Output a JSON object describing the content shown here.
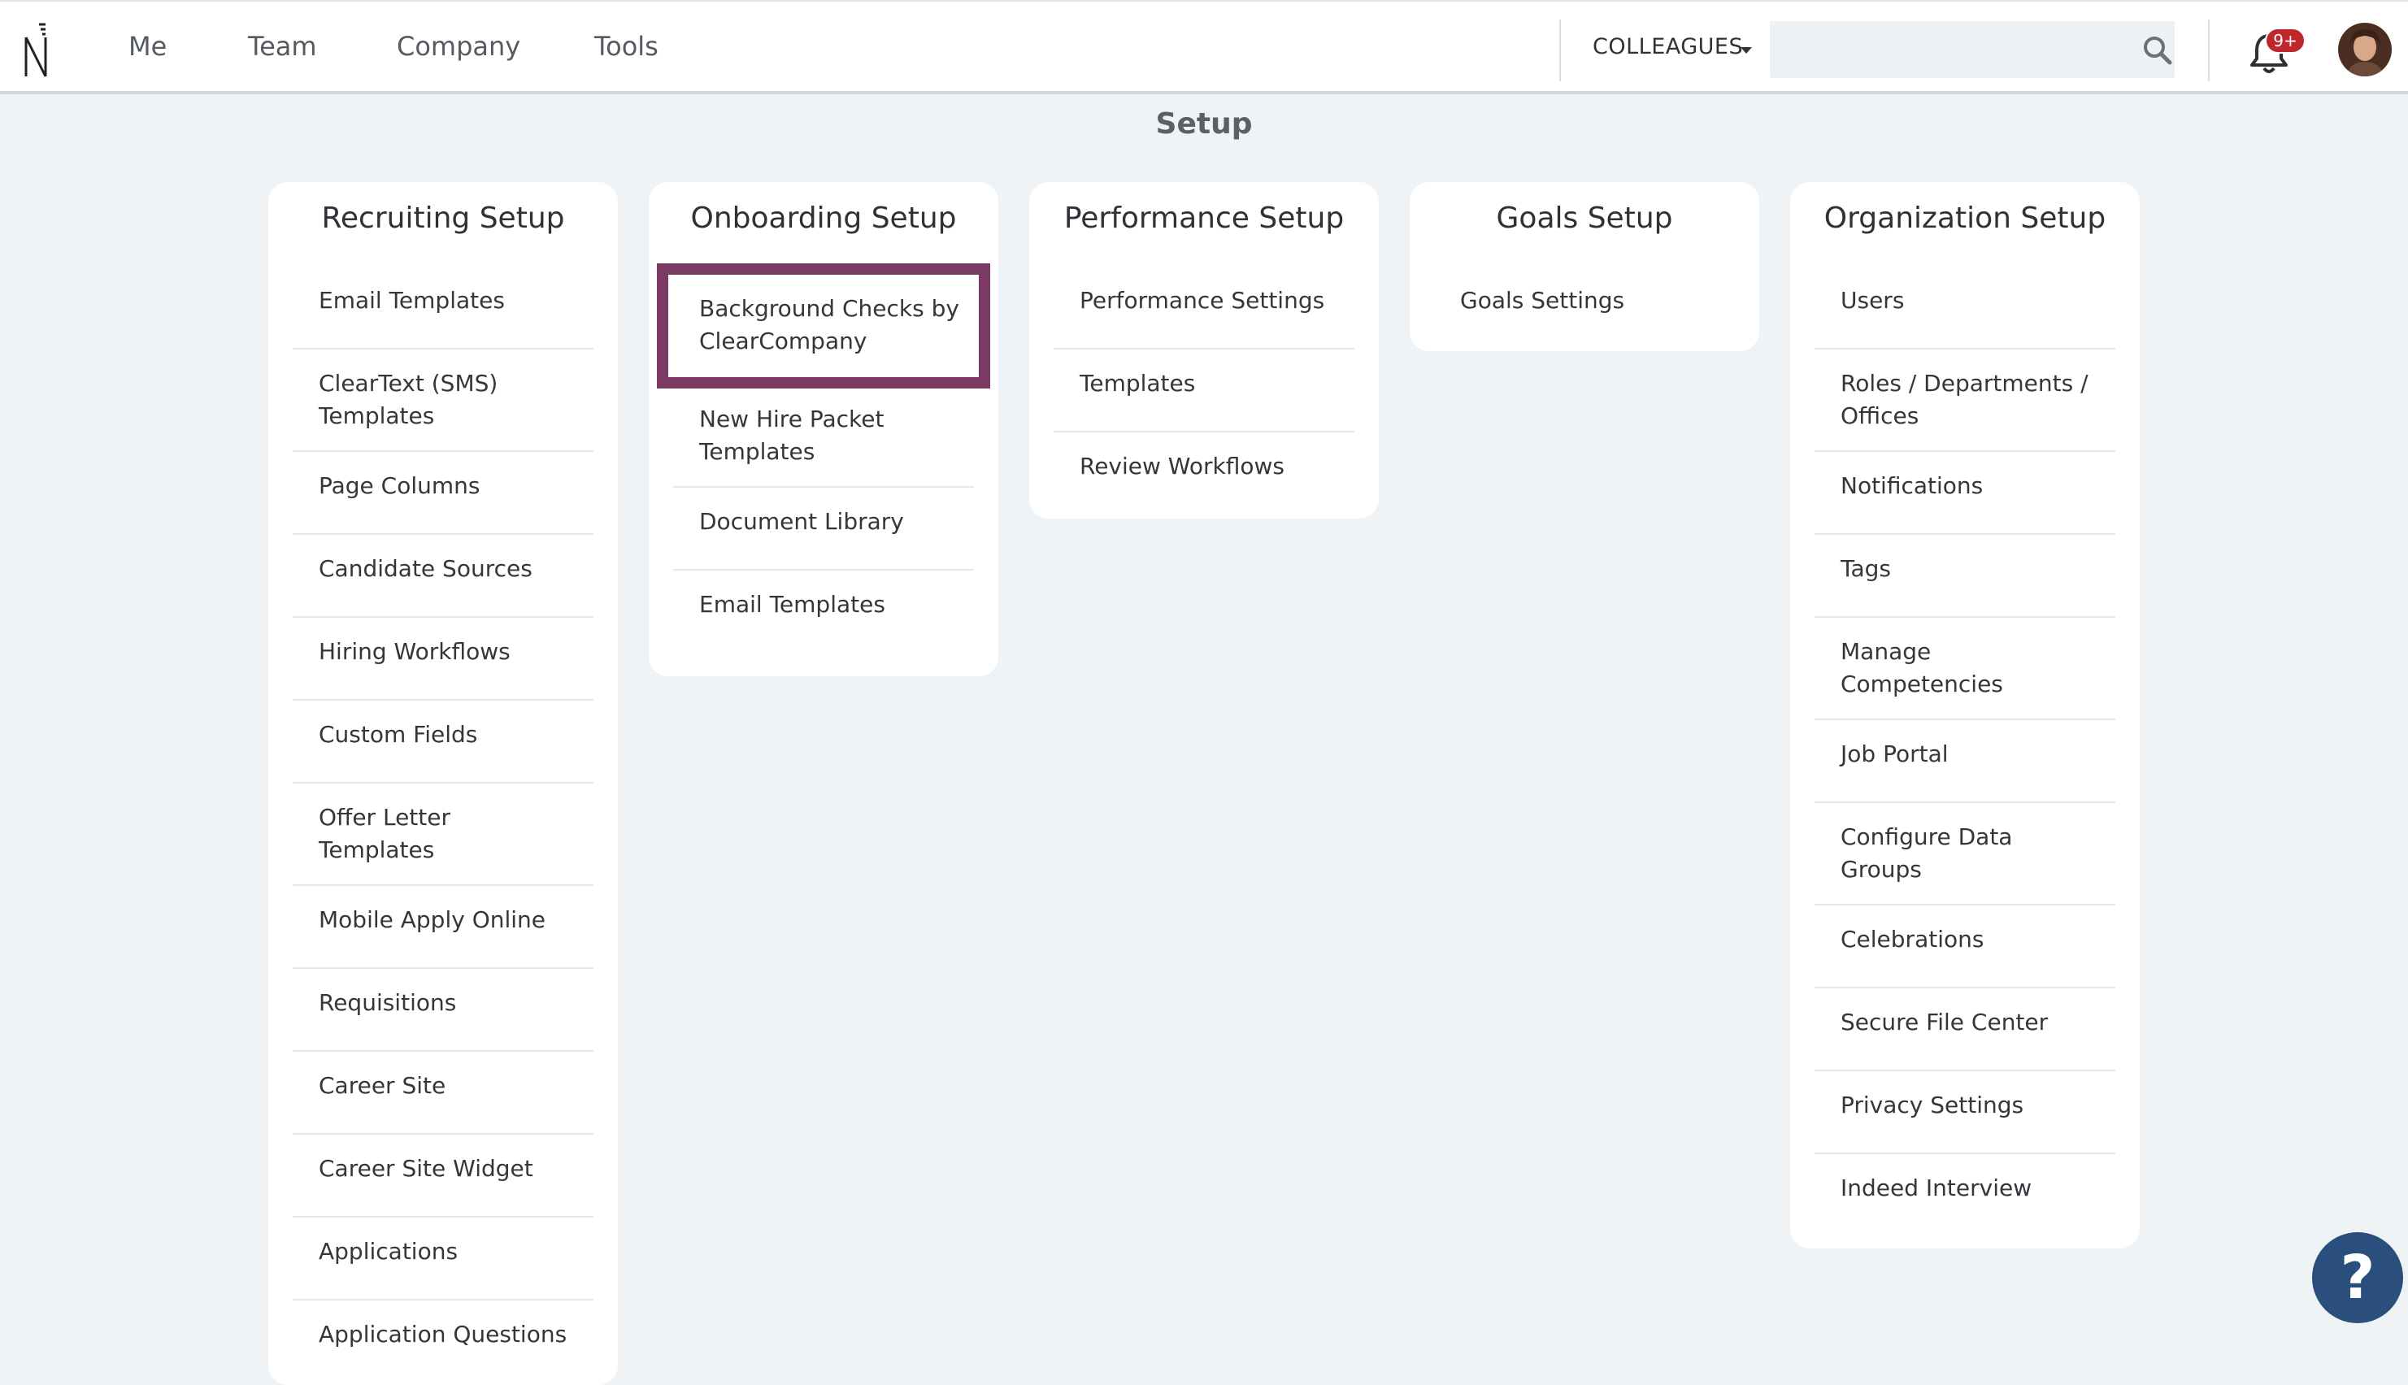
{
  "nav": {
    "items": [
      "Me",
      "Team",
      "Company",
      "Tools"
    ],
    "colleagues_label": "COLLEAGUES",
    "search_placeholder": "",
    "notification_badge": "9+"
  },
  "page": {
    "title": "Setup"
  },
  "cards": [
    {
      "title": "Recruiting Setup",
      "items": [
        "Email Templates",
        "ClearText (SMS) Templates",
        "Page Columns",
        "Candidate Sources",
        "Hiring Workflows",
        "Custom Fields",
        "Offer Letter Templates",
        "Mobile Apply Online",
        "Requisitions",
        "Career Site",
        "Career Site Widget",
        "Applications",
        "Application Questions"
      ]
    },
    {
      "title": "Onboarding Setup",
      "items": [
        "Background Checks by ClearCompany",
        "New Hire Packet Templates",
        "Document Library",
        "Email Templates"
      ],
      "highlighted_item": "Background Checks by ClearCompany"
    },
    {
      "title": "Performance Setup",
      "items": [
        "Performance Settings",
        "Templates",
        "Review Workflows"
      ]
    },
    {
      "title": "Goals Setup",
      "items": [
        "Goals Settings"
      ]
    },
    {
      "title": "Organization Setup",
      "items": [
        "Users",
        "Roles / Departments / Offices",
        "Notifications",
        "Tags",
        "Manage Competencies",
        "Job Portal",
        "Configure Data Groups",
        "Celebrations",
        "Secure File Center",
        "Privacy Settings",
        "Indeed Interview"
      ]
    }
  ],
  "help": {
    "label": "?"
  },
  "colors": {
    "highlight": "#7b3a63",
    "help_button": "#2a4f7d",
    "badge": "#c0272d"
  },
  "icons": [
    "logo-icon",
    "search-icon",
    "bell-icon",
    "avatar",
    "help-icon"
  ]
}
